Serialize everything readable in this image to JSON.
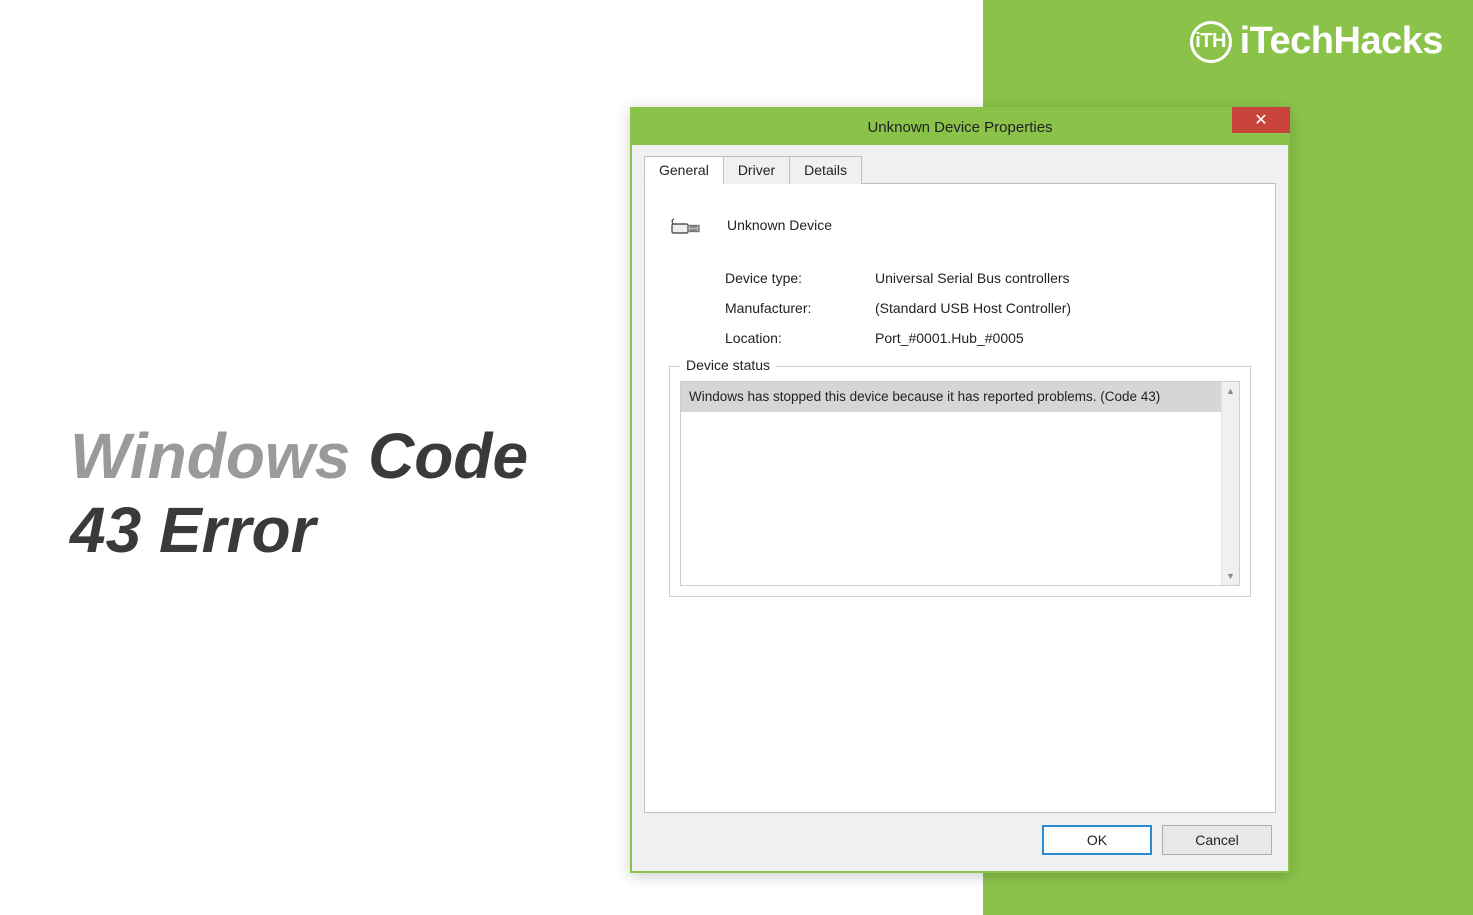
{
  "branding": {
    "logo_text": "iTechHacks",
    "logo_badge": "iTH"
  },
  "headline": {
    "line1_light": "Windows",
    "line1_dark": " Code",
    "line2": "43 Error"
  },
  "dialog": {
    "title": "Unknown Device Properties",
    "tabs": [
      "General",
      "Driver",
      "Details"
    ],
    "active_tab": 0,
    "device_name": "Unknown Device",
    "properties": [
      {
        "label": "Device type:",
        "value": "Universal Serial Bus controllers"
      },
      {
        "label": "Manufacturer:",
        "value": "(Standard USB Host Controller)"
      },
      {
        "label": "Location:",
        "value": "Port_#0001.Hub_#0005"
      }
    ],
    "status_legend": "Device status",
    "status_text": "Windows has stopped this device because it has reported problems. (Code 43)",
    "buttons": {
      "ok": "OK",
      "cancel": "Cancel"
    }
  }
}
